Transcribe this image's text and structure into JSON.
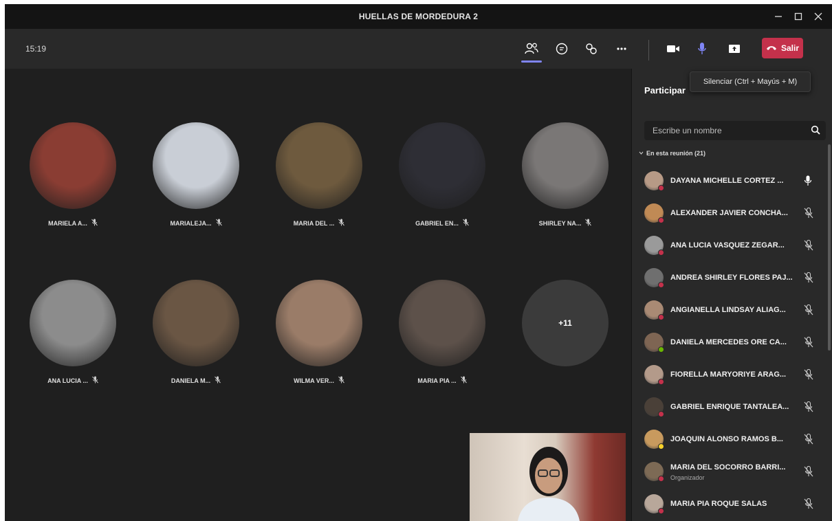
{
  "window": {
    "title": "HUELLAS DE MORDEDURA 2"
  },
  "toolbar": {
    "clock": "15:19",
    "leave_label": "Salir"
  },
  "tooltip": "Silenciar (Ctrl + Mayús + M)",
  "grid": {
    "tiles": [
      {
        "label": "MARIELA A...",
        "color": "#8a3d33"
      },
      {
        "label": "MARIALEJA...",
        "color": "#c9ced6"
      },
      {
        "label": "MARIA DEL ...",
        "color": "#6e5a3e"
      },
      {
        "label": "GABRIEL EN...",
        "color": "#2e2e35"
      },
      {
        "label": "SHIRLEY NA...",
        "color": "#7a7776"
      },
      {
        "label": "ANA LUCIA ...",
        "color": "#8c8c8c"
      },
      {
        "label": "DANIELA M...",
        "color": "#6a5644"
      },
      {
        "label": "WILMA VER...",
        "color": "#9a7c68"
      },
      {
        "label": "MARIA PIA ...",
        "color": "#5d514a"
      }
    ],
    "more": "+11"
  },
  "panel": {
    "title": "Participar",
    "search_placeholder": "Escribe un nombre",
    "section_label": "En esta reunión (21)",
    "participants": [
      {
        "name": "DAYANA MICHELLE CORTEZ ...",
        "role": "",
        "color": "#b79a86",
        "status": "#c4314b",
        "mic": "on"
      },
      {
        "name": "ALEXANDER JAVIER CONCHA...",
        "role": "",
        "color": "#c08a55",
        "status": "#c4314b",
        "mic": "off"
      },
      {
        "name": "ANA LUCIA VASQUEZ ZEGAR...",
        "role": "",
        "color": "#9a9a9a",
        "status": "#c4314b",
        "mic": "off"
      },
      {
        "name": "ANDREA SHIRLEY FLORES PAJ...",
        "role": "",
        "color": "#6f6f6f",
        "status": "#c4314b",
        "mic": "off"
      },
      {
        "name": "ANGIANELLA LINDSAY ALIAG...",
        "role": "",
        "color": "#a98a74",
        "status": "#c4314b",
        "mic": "off"
      },
      {
        "name": "DANIELA MERCEDES ORE CA...",
        "role": "",
        "color": "#7e6553",
        "status": "#6bb700",
        "mic": "off"
      },
      {
        "name": "FIORELLA MARYORIYE ARAG...",
        "role": "",
        "color": "#b39a8a",
        "status": "#c4314b",
        "mic": "off"
      },
      {
        "name": "GABRIEL ENRIQUE TANTALEA...",
        "role": "",
        "color": "#4a4038",
        "status": "#c4314b",
        "mic": "off"
      },
      {
        "name": "JOAQUIN ALONSO RAMOS B...",
        "role": "",
        "color": "#c89a5e",
        "status": "#f8d22a",
        "mic": "off"
      },
      {
        "name": "MARIA DEL SOCORRO BARRI...",
        "role": "Organizador",
        "color": "#7d6a55",
        "status": "#c4314b",
        "mic": "off"
      },
      {
        "name": "MARIA PIA ROQUE SALAS",
        "role": "",
        "color": "#b8a79a",
        "status": "#c4314b",
        "mic": "off"
      }
    ]
  },
  "colors": {
    "leave": "#c4314b",
    "accent": "#7f85f5",
    "mic_on": "#7f85f5"
  }
}
